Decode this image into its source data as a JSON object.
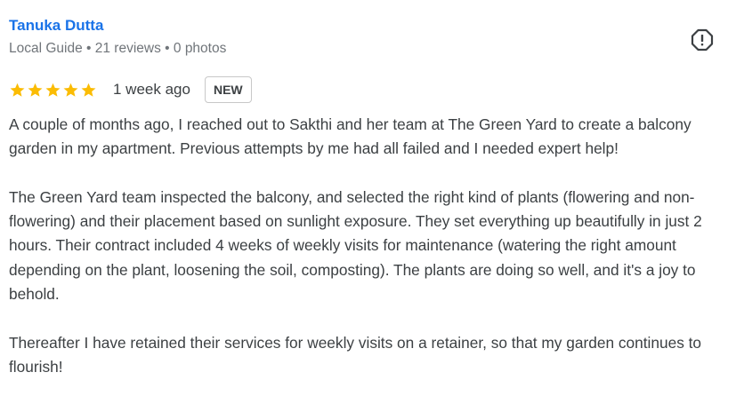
{
  "reviewer": {
    "name": "Tanuka Dutta",
    "meta": "Local Guide • 21 reviews • 0 photos"
  },
  "rating": {
    "stars": 5,
    "max_stars": 5,
    "star_color": "#fbbc04",
    "date": "1 week ago",
    "badge": "NEW"
  },
  "icons": {
    "report": "report-flag-icon",
    "star": "star-icon"
  },
  "colors": {
    "name_link": "#1a73e8",
    "meta_text": "#70757a",
    "body_text": "#3c4043"
  },
  "review": {
    "paragraphs": [
      "A couple of months ago, I reached out to Sakthi and her team at The Green Yard to create a balcony garden in my apartment. Previous attempts by me had all failed and I needed expert help!",
      "The Green Yard team inspected the balcony, and selected the right kind of plants (flowering and non-flowering) and their placement based on sunlight exposure. They set everything up beautifully in just 2 hours. Their contract included 4 weeks of weekly visits for maintenance (watering the right amount depending on the plant, loosening the soil, composting). The plants are doing so well, and it's a joy to behold.",
      "Thereafter I have retained their services for weekly visits on a retainer, so that my garden continues to flourish!"
    ]
  }
}
